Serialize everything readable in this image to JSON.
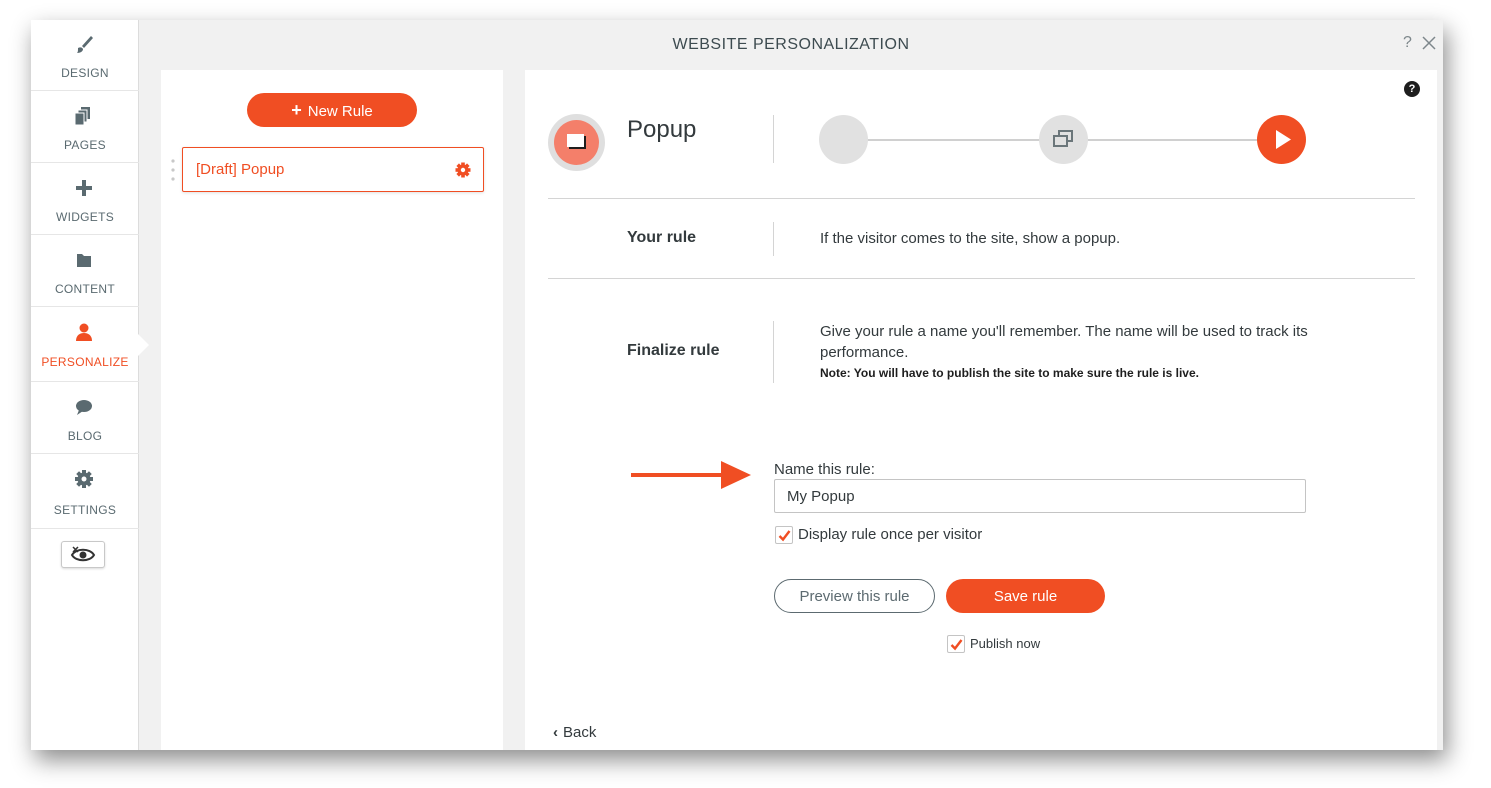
{
  "window": {
    "title": "WEBSITE PERSONALIZATION",
    "help_glyph": "?",
    "close_icon": "close-icon"
  },
  "sidebar": {
    "items": [
      {
        "label": "DESIGN",
        "icon": "brush-icon"
      },
      {
        "label": "PAGES",
        "icon": "pages-icon"
      },
      {
        "label": "WIDGETS",
        "icon": "plus-icon"
      },
      {
        "label": "CONTENT",
        "icon": "folder-icon"
      },
      {
        "label": "PERSONALIZE",
        "icon": "user-icon",
        "active": true
      },
      {
        "label": "BLOG",
        "icon": "chat-bubble-icon"
      },
      {
        "label": "SETTINGS",
        "icon": "gear-icon"
      }
    ],
    "preview_toggle_icon": "eye-crossed-icon"
  },
  "rules_panel": {
    "new_rule_label": "New Rule",
    "rules": [
      {
        "label": "[Draft] Popup",
        "icon": "gear-icon"
      }
    ]
  },
  "main": {
    "rule_type": "Popup",
    "help_glyph": "?",
    "steps": [
      {
        "state": "complete",
        "icon": ""
      },
      {
        "state": "complete",
        "icon": "popup-windows-icon"
      },
      {
        "state": "active",
        "icon": "play-icon"
      }
    ],
    "your_rule": {
      "label": "Your rule",
      "text": "If the visitor comes to the site, show a popup."
    },
    "finalize": {
      "label": "Finalize rule",
      "text": "Give your rule a name you'll remember. The name will be used to track its performance.",
      "note": "Note: You will have to publish the site to make sure the rule is live."
    },
    "name_field": {
      "label": "Name this rule:",
      "value": "My Popup"
    },
    "display_once": {
      "label": "Display rule once per visitor",
      "checked": true
    },
    "buttons": {
      "preview": "Preview this rule",
      "save": "Save rule"
    },
    "publish_now": {
      "label": "Publish now",
      "checked": true
    },
    "back_label": "Back",
    "back_glyph": "‹"
  },
  "colors": {
    "accent": "#f04e23",
    "text": "#333a3d",
    "muted": "#5a6a70"
  }
}
